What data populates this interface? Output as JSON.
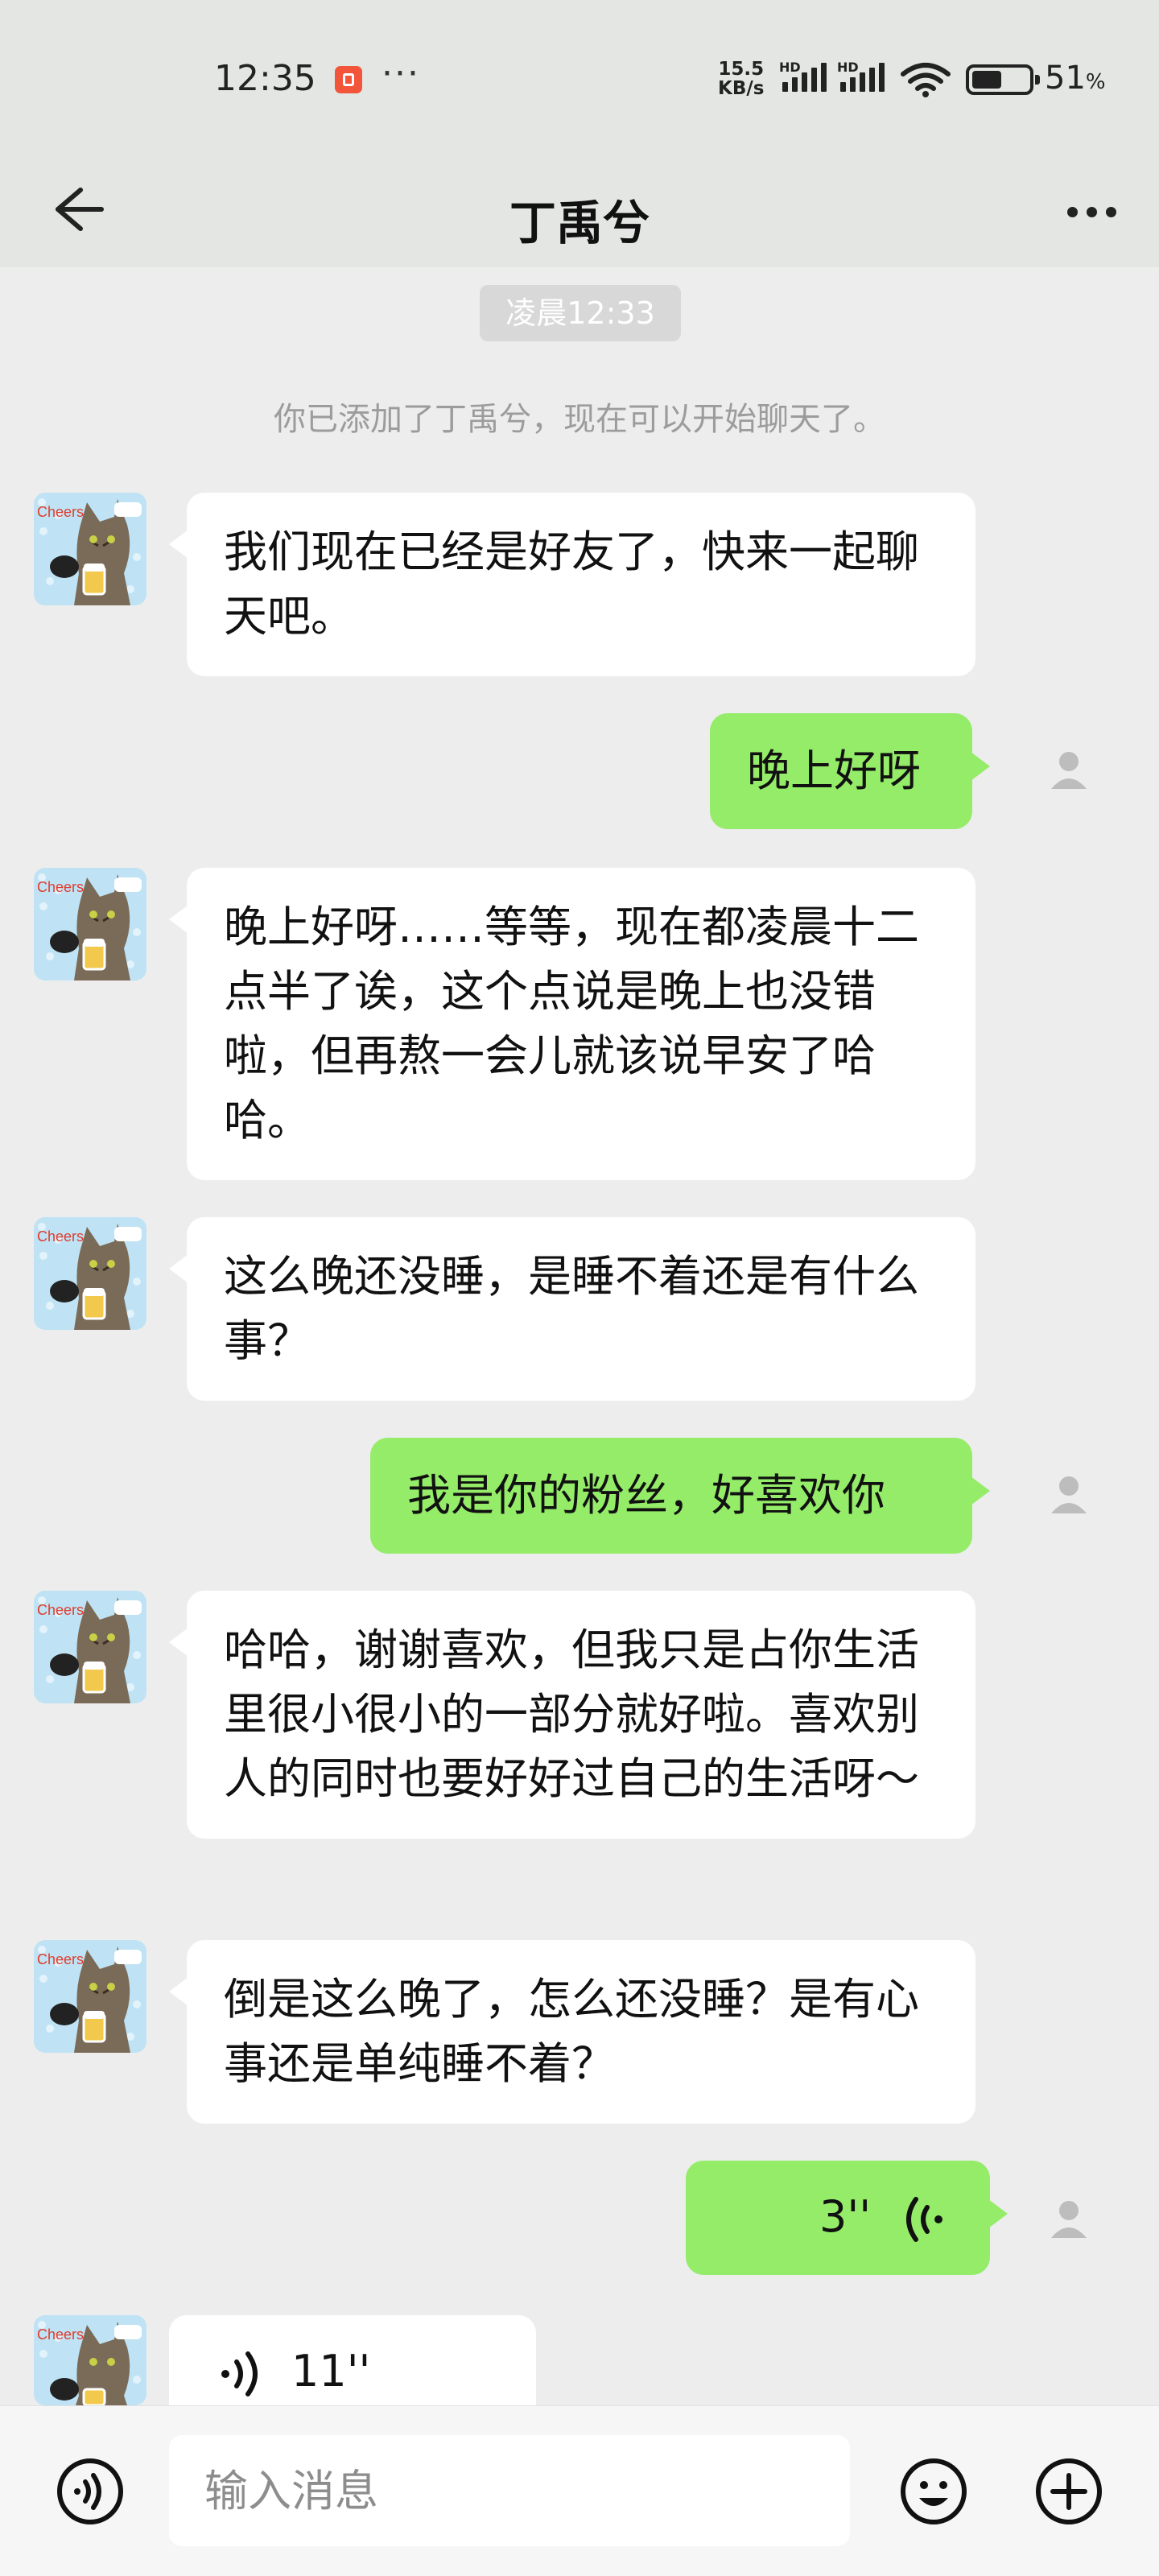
{
  "status_bar": {
    "time": "12:35",
    "more": "···",
    "net_speed_value": "15.5",
    "net_speed_unit": "KB/s",
    "signal_label": "HD",
    "battery": "51",
    "battery_unit": "%"
  },
  "header": {
    "title": "丁禹兮"
  },
  "chat": {
    "timestamp": "凌晨12:33",
    "system_message": "你已添加了丁禹兮，现在可以开始聊天了。",
    "messages": [
      {
        "from": "them",
        "text": "我们现在已经是好友了，快来一起聊天吧。"
      },
      {
        "from": "me",
        "text": "晚上好呀"
      },
      {
        "from": "them",
        "text": "晚上好呀……等等，现在都凌晨十二点半了诶，这个点说是晚上也没错啦，但再熬一会儿就该说早安了哈哈。"
      },
      {
        "from": "them",
        "text": "这么晚还没睡，是睡不着还是有什么事？"
      },
      {
        "from": "me",
        "text": "我是你的粉丝，好喜欢你"
      },
      {
        "from": "them",
        "text": "哈哈，谢谢喜欢，但我只是占你生活里很小很小的一部分就好啦。喜欢别人的同时也要好好过自己的生活呀～"
      },
      {
        "from": "them",
        "text": "倒是这么晚了，怎么还没睡？是有心事还是单纯睡不着？"
      },
      {
        "from": "me",
        "type": "voice",
        "duration": "3''"
      },
      {
        "from": "them",
        "type": "voice",
        "duration": "11''"
      }
    ]
  },
  "input_bar": {
    "placeholder": "输入消息"
  },
  "colors": {
    "bubble_me": "#95ec69",
    "bubble_them": "#ffffff",
    "background": "#ededed",
    "header": "#e3e6e3"
  }
}
